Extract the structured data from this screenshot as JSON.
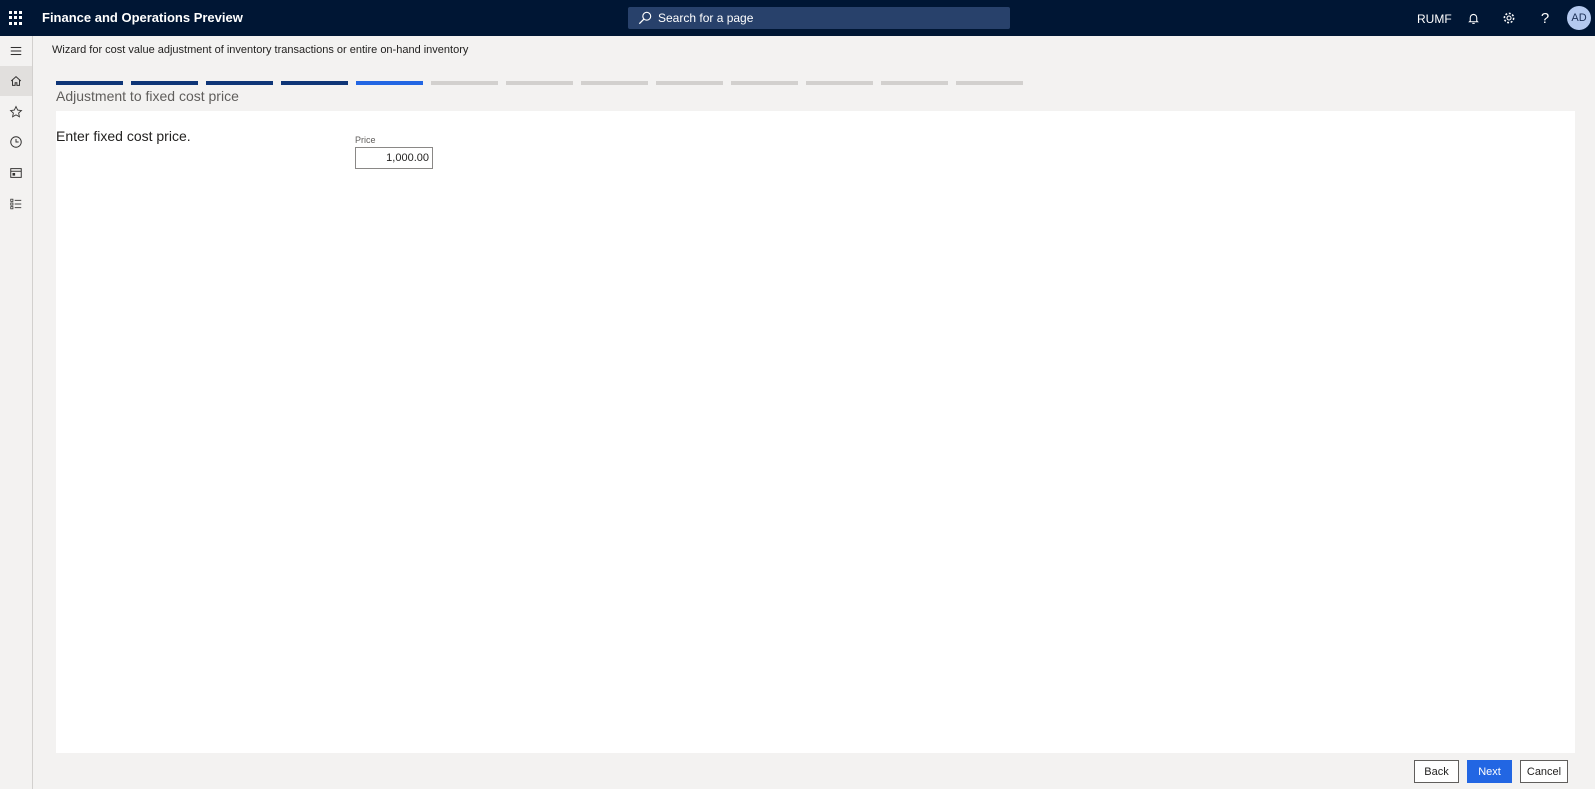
{
  "app": {
    "title": "Finance and Operations Preview"
  },
  "search": {
    "placeholder": "Search for a page"
  },
  "header": {
    "company": "RUMF",
    "avatar_initials": "AD",
    "icons": [
      "waffle-icon",
      "bell-icon",
      "gear-icon",
      "help-icon"
    ]
  },
  "sidenav": {
    "items": [
      "hamburger-icon",
      "home-icon",
      "star-icon",
      "clock-icon",
      "workspace-icon",
      "list-icon"
    ]
  },
  "wizard": {
    "title": "Wizard for cost value adjustment of inventory transactions or entire on-hand inventory",
    "steps_total": 13,
    "steps_completed": 4,
    "current_step": 5,
    "step_title": "Adjustment to fixed cost price",
    "instruction": "Enter fixed cost price.",
    "fields": {
      "price": {
        "label": "Price",
        "value": "1,000.00"
      }
    }
  },
  "buttons": {
    "back": "Back",
    "next": "Next",
    "cancel": "Cancel"
  },
  "colors": {
    "topbar": "#001634",
    "accent": "#2266e3",
    "step_done": "#0e3577",
    "step_pending": "#d2d0ce"
  }
}
